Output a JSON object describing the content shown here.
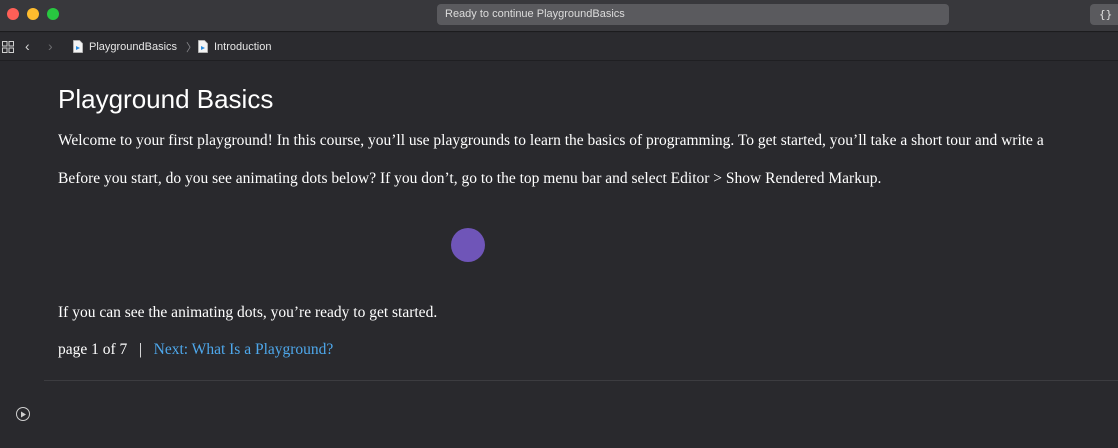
{
  "window": {
    "activity_text": "Ready to continue PlaygroundBasics",
    "library_button_label": "{}",
    "traffic_colors": {
      "close": "#fe5f57",
      "minimize": "#febc2e",
      "maximize": "#28c840"
    }
  },
  "jumpbar": {
    "breadcrumbs": [
      {
        "label": "PlaygroundBasics",
        "icon": "playground-file-icon"
      },
      {
        "label": "Introduction",
        "icon": "playground-page-icon"
      }
    ],
    "separator": "〉"
  },
  "page": {
    "title": "Playground Basics",
    "paragraphs": [
      "Welcome to your first playground! In this course, you’ll use playgrounds to learn the basics of programming. To get started, you’ll take a short tour and write a",
      "Before you start, do you see animating dots below? If you don’t, go to the top menu bar and select Editor > Show Rendered Markup.",
      "If you can see the animating dots, you’re ready to get started."
    ],
    "pager": {
      "page_text": "page 1 of 7",
      "separator": "|",
      "next_label": "Next: What Is a Playground?"
    },
    "dot_color": "#6f55b8",
    "link_color": "#4ea8ec"
  }
}
